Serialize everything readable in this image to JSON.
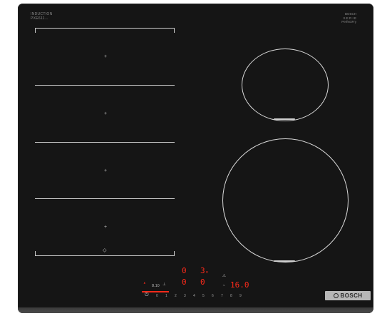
{
  "brand_top_left": {
    "line1": "INDUCTION",
    "line2": "PXE611..."
  },
  "brand_top_right": {
    "line1": "BOSCH",
    "line2": "S E R I E",
    "line3": "PerfectFry"
  },
  "flex_zones": [
    {
      "label": "+"
    },
    {
      "label": "+"
    },
    {
      "label": "+"
    },
    {
      "label": "+"
    }
  ],
  "flex_marker": "⬦",
  "control_panel": {
    "display_left_top": "0",
    "display_left_bottom": "0",
    "display_mid_top": "3",
    "display_mid_top_sub": "n",
    "display_mid_bottom": "0",
    "timer_value": "16.0",
    "small_left_label": "8.10",
    "power_symbol": "⏻",
    "slider_numbers": [
      "0",
      "1",
      "2",
      "3",
      "4",
      "5",
      "6",
      "7",
      "8",
      "9"
    ],
    "icons": {
      "child_lock": "child-lock-icon",
      "timer": "timer-icon",
      "warning": "warning-icon"
    }
  },
  "logo": {
    "text": "BOSCH"
  },
  "colors": {
    "surface": "#151515",
    "display_red": "#ff2a1a",
    "lines": "#cfcfcf",
    "logo_plate": "#b7b7b7"
  }
}
